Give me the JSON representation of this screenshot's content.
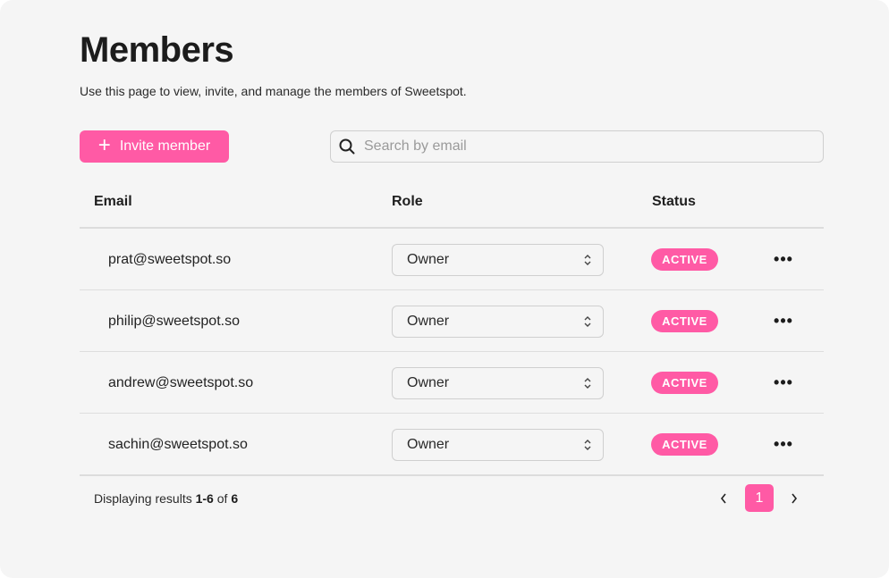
{
  "page": {
    "title": "Members",
    "subtitle": "Use this page to view, invite, and manage the members of Sweetspot."
  },
  "toolbar": {
    "invite_label": "Invite member",
    "search_placeholder": "Search by email",
    "search_value": ""
  },
  "table": {
    "headers": {
      "email": "Email",
      "role": "Role",
      "status": "Status"
    },
    "rows": [
      {
        "email": "prat@sweetspot.so",
        "role": "Owner",
        "status": "ACTIVE"
      },
      {
        "email": "philip@sweetspot.so",
        "role": "Owner",
        "status": "ACTIVE"
      },
      {
        "email": "andrew@sweetspot.so",
        "role": "Owner",
        "status": "ACTIVE"
      },
      {
        "email": "sachin@sweetspot.so",
        "role": "Owner",
        "status": "ACTIVE"
      }
    ]
  },
  "footer": {
    "results_prefix": "Displaying results ",
    "results_range": "1-6",
    "results_of": " of ",
    "results_total": "6",
    "current_page": "1"
  },
  "colors": {
    "accent": "#ff5aa5",
    "background": "#f5f5f5"
  },
  "icons": {
    "invite": "plus-icon",
    "search": "search-icon",
    "role_select": "chevron-up-down-icon",
    "row_actions": "more-horizontal-icon",
    "prev": "chevron-left-icon",
    "next": "chevron-right-icon"
  }
}
